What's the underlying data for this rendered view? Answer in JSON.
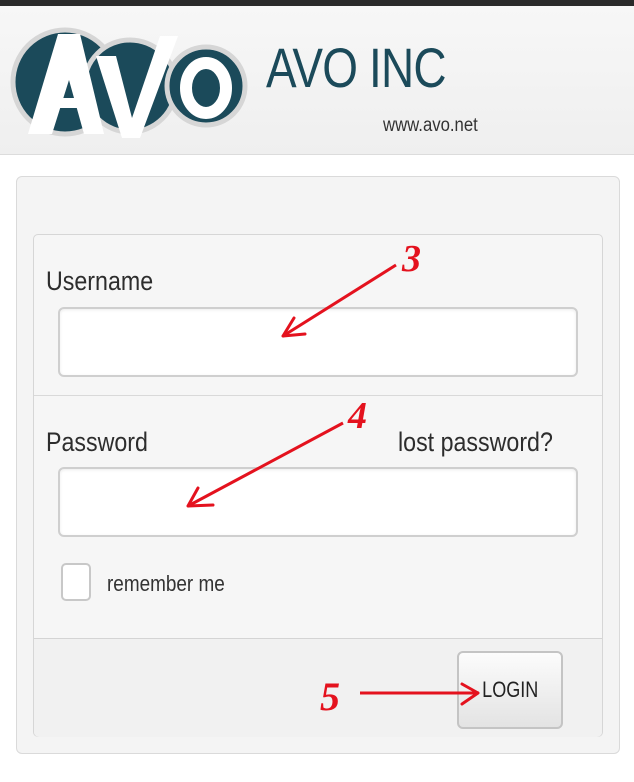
{
  "header": {
    "logo_mark": "AVO",
    "company_name": "AVO INC",
    "company_url": "www.avo.net"
  },
  "form": {
    "username_label": "Username",
    "username_value": "",
    "password_label": "Password",
    "password_value": "",
    "lost_password_link": "lost password?",
    "remember_label": "remember me",
    "remember_checked": false,
    "login_label": "LOGIN"
  },
  "annotations": {
    "step_3": "3",
    "step_4": "4",
    "step_5": "5"
  },
  "colors": {
    "brand_dark": "#1b4a5a",
    "annotation_red": "#e4121e"
  },
  "icons": [
    "checkbox-icon",
    "arrow-icon"
  ]
}
